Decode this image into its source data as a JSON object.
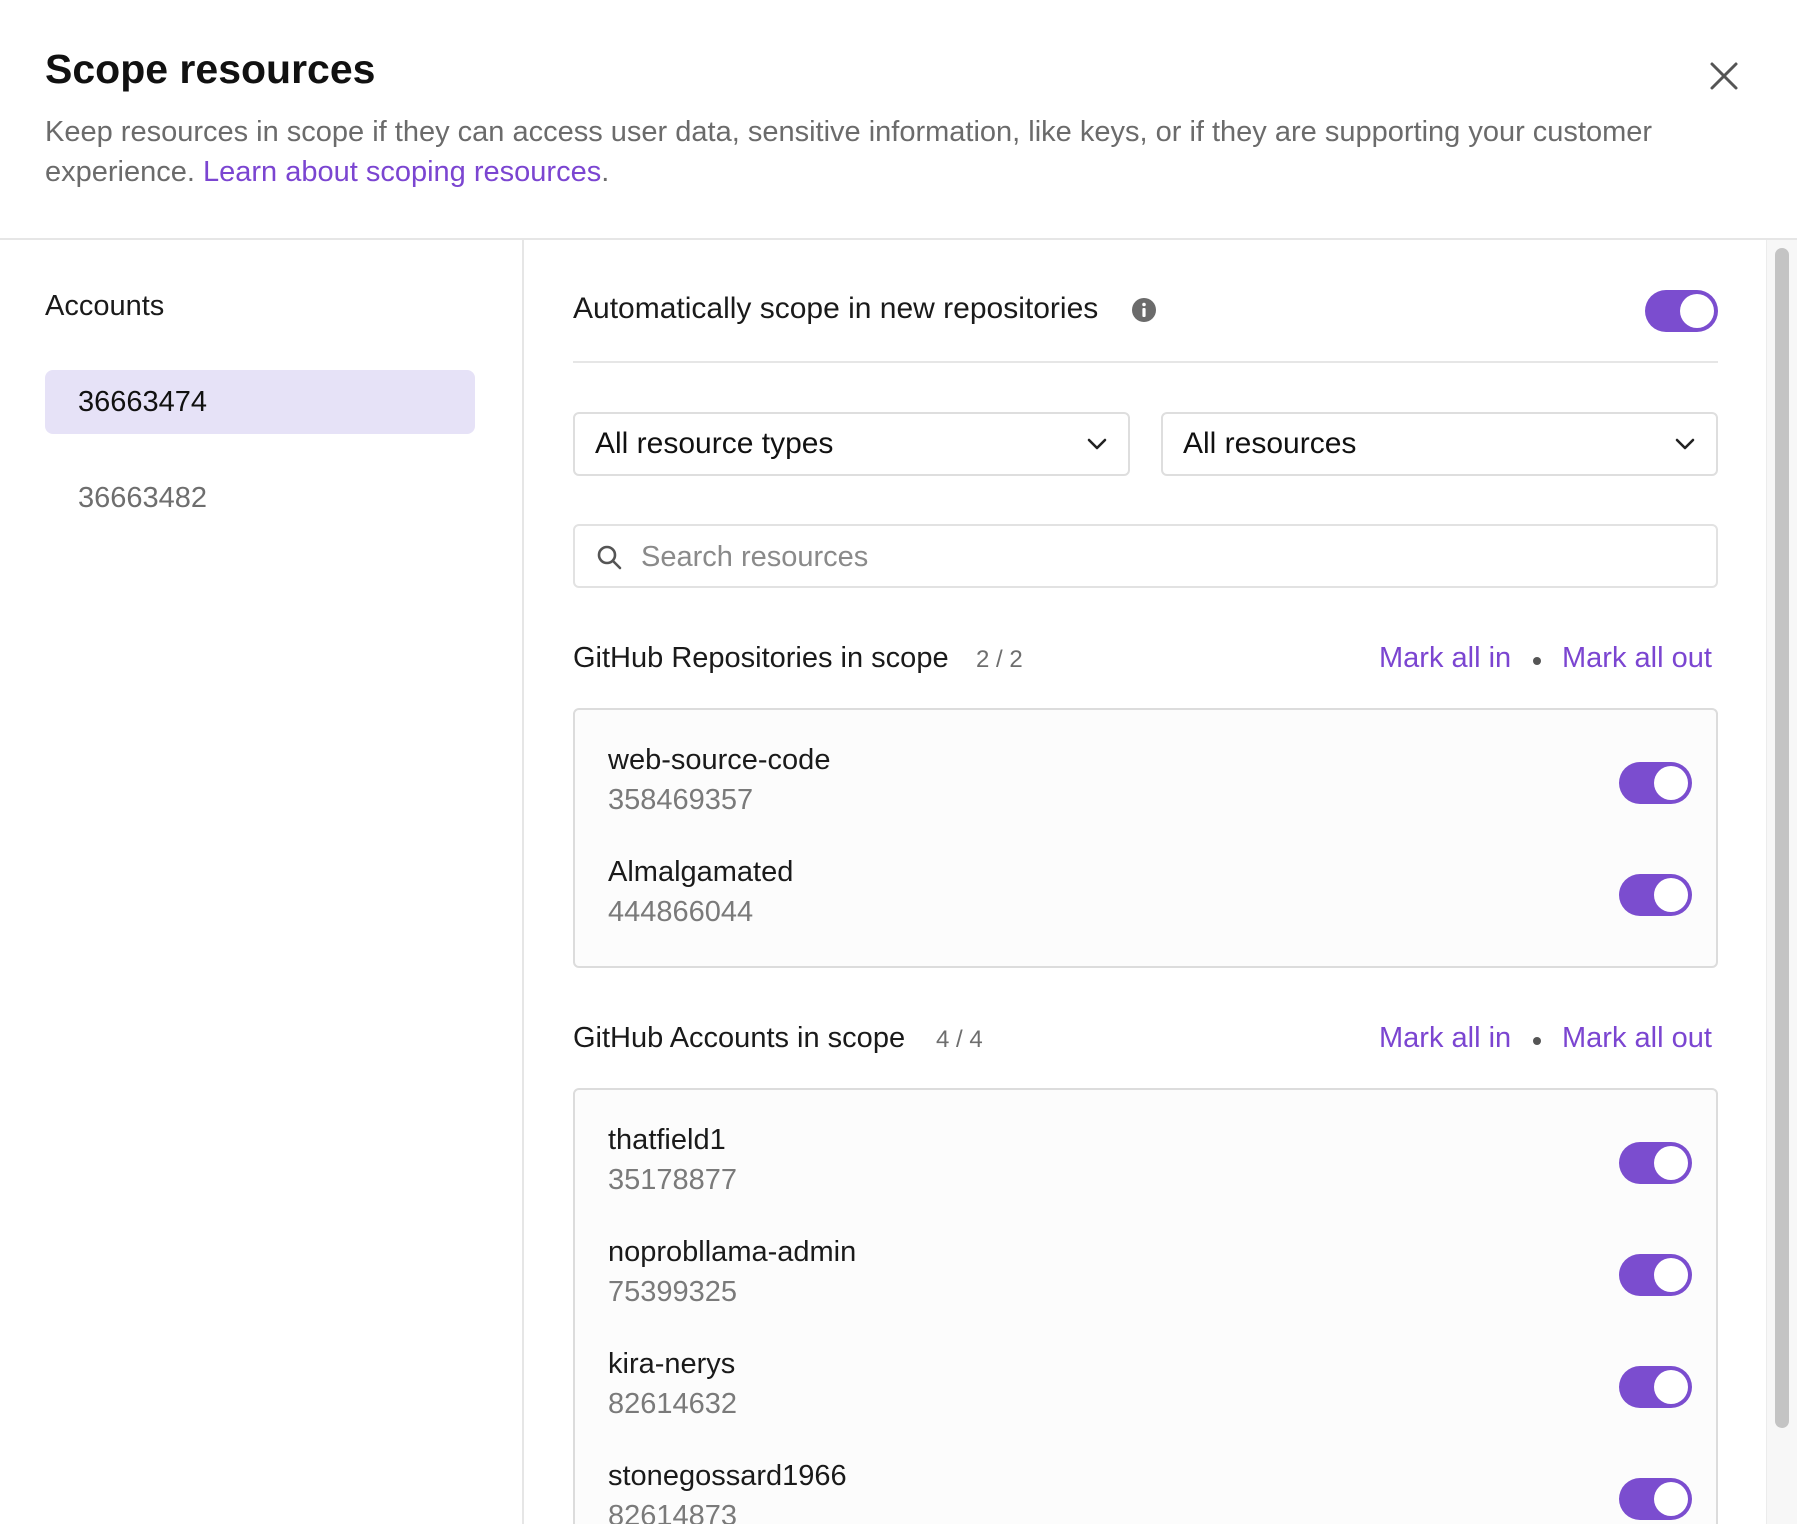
{
  "header": {
    "title": "Scope resources",
    "description": "Keep resources in scope if they can access user data, sensitive information, like keys, or if they are supporting your customer experience.",
    "learn_link": "Learn about scoping resources",
    "trailing_period": "."
  },
  "sidebar": {
    "heading": "Accounts",
    "accounts": [
      {
        "label": "36663474",
        "selected": true
      },
      {
        "label": "36663482",
        "selected": false
      }
    ]
  },
  "auto_scope": {
    "label": "Automatically scope in new repositories",
    "enabled": true
  },
  "filters": {
    "resource_type": "All resource types",
    "resources": "All resources"
  },
  "search": {
    "placeholder": "Search resources",
    "value": ""
  },
  "sections": [
    {
      "title": "GitHub Repositories in scope",
      "count": "2 / 2",
      "mark_in": "Mark all in",
      "mark_out": "Mark all out",
      "items": [
        {
          "name": "web-source-code",
          "id": "358469357",
          "enabled": true
        },
        {
          "name": "Almalgamated",
          "id": "444866044",
          "enabled": true
        }
      ]
    },
    {
      "title": "GitHub Accounts in scope",
      "count": "4 / 4",
      "mark_in": "Mark all in",
      "mark_out": "Mark all out",
      "items": [
        {
          "name": "thatfield1",
          "id": "35178877",
          "enabled": true
        },
        {
          "name": "noprobllama-admin",
          "id": "75399325",
          "enabled": true
        },
        {
          "name": "kira-nerys",
          "id": "82614632",
          "enabled": true
        },
        {
          "name": "stonegossard1966",
          "id": "82614873",
          "enabled": true
        }
      ]
    }
  ],
  "colors": {
    "accent": "#7b4dcf",
    "link": "#7b45d1",
    "selected_bg": "#e6e2f7"
  },
  "icons": {
    "close": "close-icon",
    "info": "info-icon",
    "chevron": "chevron-down-icon",
    "search": "search-icon"
  }
}
